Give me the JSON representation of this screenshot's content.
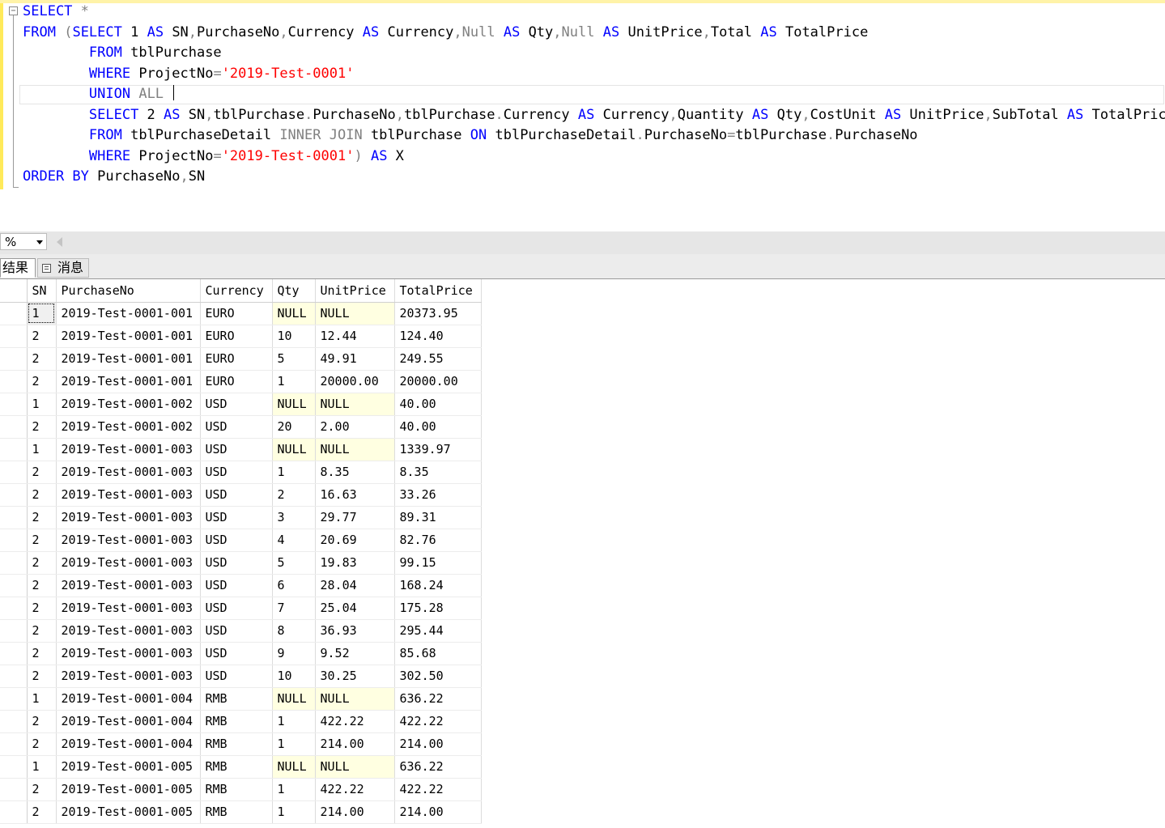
{
  "editor": {
    "collapse_symbol": "−",
    "lines": [
      [
        {
          "t": "SELECT",
          "c": "kw"
        },
        {
          "t": " ",
          "c": ""
        },
        {
          "t": "*",
          "c": "gr"
        }
      ],
      [
        {
          "t": "FROM",
          "c": "kw"
        },
        {
          "t": " ",
          "c": ""
        },
        {
          "t": "(",
          "c": "gr"
        },
        {
          "t": "SELECT",
          "c": "kw"
        },
        {
          "t": " 1 ",
          "c": ""
        },
        {
          "t": "AS",
          "c": "kw"
        },
        {
          "t": " SN",
          "c": ""
        },
        {
          "t": ",",
          "c": "gr"
        },
        {
          "t": "PurchaseNo",
          "c": ""
        },
        {
          "t": ",",
          "c": "gr"
        },
        {
          "t": "Currency ",
          "c": ""
        },
        {
          "t": "AS",
          "c": "kw"
        },
        {
          "t": " Currency",
          "c": ""
        },
        {
          "t": ",",
          "c": "gr"
        },
        {
          "t": "Null",
          "c": "gr"
        },
        {
          "t": " ",
          "c": ""
        },
        {
          "t": "AS",
          "c": "kw"
        },
        {
          "t": " Qty",
          "c": ""
        },
        {
          "t": ",",
          "c": "gr"
        },
        {
          "t": "Null",
          "c": "gr"
        },
        {
          "t": " ",
          "c": ""
        },
        {
          "t": "AS",
          "c": "kw"
        },
        {
          "t": " UnitPrice",
          "c": ""
        },
        {
          "t": ",",
          "c": "gr"
        },
        {
          "t": "Total ",
          "c": ""
        },
        {
          "t": "AS",
          "c": "kw"
        },
        {
          "t": " TotalPrice",
          "c": ""
        }
      ],
      [
        {
          "t": "        ",
          "c": ""
        },
        {
          "t": "FROM",
          "c": "kw"
        },
        {
          "t": " tblPurchase",
          "c": ""
        }
      ],
      [
        {
          "t": "        ",
          "c": ""
        },
        {
          "t": "WHERE",
          "c": "kw"
        },
        {
          "t": " ProjectNo",
          "c": ""
        },
        {
          "t": "=",
          "c": "gr"
        },
        {
          "t": "'2019-Test-0001'",
          "c": "str"
        }
      ],
      [
        {
          "t": "        ",
          "c": ""
        },
        {
          "t": "UNION",
          "c": "kw"
        },
        {
          "t": " ",
          "c": ""
        },
        {
          "t": "ALL",
          "c": "gr"
        },
        {
          "t": " ",
          "c": ""
        }
      ],
      [
        {
          "t": "        ",
          "c": ""
        },
        {
          "t": "SELECT",
          "c": "kw"
        },
        {
          "t": " 2 ",
          "c": ""
        },
        {
          "t": "AS",
          "c": "kw"
        },
        {
          "t": " SN",
          "c": ""
        },
        {
          "t": ",",
          "c": "gr"
        },
        {
          "t": "tblPurchase",
          "c": ""
        },
        {
          "t": ".",
          "c": "gr"
        },
        {
          "t": "PurchaseNo",
          "c": ""
        },
        {
          "t": ",",
          "c": "gr"
        },
        {
          "t": "tblPurchase",
          "c": ""
        },
        {
          "t": ".",
          "c": "gr"
        },
        {
          "t": "Currency ",
          "c": ""
        },
        {
          "t": "AS",
          "c": "kw"
        },
        {
          "t": " Currency",
          "c": ""
        },
        {
          "t": ",",
          "c": "gr"
        },
        {
          "t": "Quantity ",
          "c": ""
        },
        {
          "t": "AS",
          "c": "kw"
        },
        {
          "t": " Qty",
          "c": ""
        },
        {
          "t": ",",
          "c": "gr"
        },
        {
          "t": "CostUnit ",
          "c": ""
        },
        {
          "t": "AS",
          "c": "kw"
        },
        {
          "t": " UnitPrice",
          "c": ""
        },
        {
          "t": ",",
          "c": "gr"
        },
        {
          "t": "SubTotal ",
          "c": ""
        },
        {
          "t": "AS",
          "c": "kw"
        },
        {
          "t": " TotalPrice",
          "c": ""
        }
      ],
      [
        {
          "t": "        ",
          "c": ""
        },
        {
          "t": "FROM",
          "c": "kw"
        },
        {
          "t": " tblPurchaseDetail ",
          "c": ""
        },
        {
          "t": "INNER",
          "c": "gr"
        },
        {
          "t": " ",
          "c": ""
        },
        {
          "t": "JOIN",
          "c": "gr"
        },
        {
          "t": " tblPurchase ",
          "c": ""
        },
        {
          "t": "ON",
          "c": "kw"
        },
        {
          "t": " tblPurchaseDetail",
          "c": ""
        },
        {
          "t": ".",
          "c": "gr"
        },
        {
          "t": "PurchaseNo",
          "c": ""
        },
        {
          "t": "=",
          "c": "gr"
        },
        {
          "t": "tblPurchase",
          "c": ""
        },
        {
          "t": ".",
          "c": "gr"
        },
        {
          "t": "PurchaseNo",
          "c": ""
        }
      ],
      [
        {
          "t": "        ",
          "c": ""
        },
        {
          "t": "WHERE",
          "c": "kw"
        },
        {
          "t": " ProjectNo",
          "c": ""
        },
        {
          "t": "=",
          "c": "gr"
        },
        {
          "t": "'2019-Test-0001'",
          "c": "str"
        },
        {
          "t": ")",
          "c": "gr"
        },
        {
          "t": " ",
          "c": ""
        },
        {
          "t": "AS",
          "c": "kw"
        },
        {
          "t": " X",
          "c": ""
        }
      ],
      [
        {
          "t": "ORDER BY",
          "c": "kw"
        },
        {
          "t": " PurchaseNo",
          "c": ""
        },
        {
          "t": ",",
          "c": "gr"
        },
        {
          "t": "SN",
          "c": ""
        }
      ]
    ]
  },
  "zoom": {
    "value": "%"
  },
  "tabs": {
    "results": "结果",
    "messages": "消息"
  },
  "grid": {
    "columns": [
      "SN",
      "PurchaseNo",
      "Currency",
      "Qty",
      "UnitPrice",
      "TotalPrice"
    ],
    "rows": [
      [
        "1",
        "2019-Test-0001-001",
        "EURO",
        "NULL",
        "NULL",
        "20373.95"
      ],
      [
        "2",
        "2019-Test-0001-001",
        "EURO",
        "10",
        "12.44",
        "124.40"
      ],
      [
        "2",
        "2019-Test-0001-001",
        "EURO",
        "5",
        "49.91",
        "249.55"
      ],
      [
        "2",
        "2019-Test-0001-001",
        "EURO",
        "1",
        "20000.00",
        "20000.00"
      ],
      [
        "1",
        "2019-Test-0001-002",
        "USD",
        "NULL",
        "NULL",
        "40.00"
      ],
      [
        "2",
        "2019-Test-0001-002",
        "USD",
        "20",
        "2.00",
        "40.00"
      ],
      [
        "1",
        "2019-Test-0001-003",
        "USD",
        "NULL",
        "NULL",
        "1339.97"
      ],
      [
        "2",
        "2019-Test-0001-003",
        "USD",
        "1",
        "8.35",
        "8.35"
      ],
      [
        "2",
        "2019-Test-0001-003",
        "USD",
        "2",
        "16.63",
        "33.26"
      ],
      [
        "2",
        "2019-Test-0001-003",
        "USD",
        "3",
        "29.77",
        "89.31"
      ],
      [
        "2",
        "2019-Test-0001-003",
        "USD",
        "4",
        "20.69",
        "82.76"
      ],
      [
        "2",
        "2019-Test-0001-003",
        "USD",
        "5",
        "19.83",
        "99.15"
      ],
      [
        "2",
        "2019-Test-0001-003",
        "USD",
        "6",
        "28.04",
        "168.24"
      ],
      [
        "2",
        "2019-Test-0001-003",
        "USD",
        "7",
        "25.04",
        "175.28"
      ],
      [
        "2",
        "2019-Test-0001-003",
        "USD",
        "8",
        "36.93",
        "295.44"
      ],
      [
        "2",
        "2019-Test-0001-003",
        "USD",
        "9",
        "9.52",
        "85.68"
      ],
      [
        "2",
        "2019-Test-0001-003",
        "USD",
        "10",
        "30.25",
        "302.50"
      ],
      [
        "1",
        "2019-Test-0001-004",
        "RMB",
        "NULL",
        "NULL",
        "636.22"
      ],
      [
        "2",
        "2019-Test-0001-004",
        "RMB",
        "1",
        "422.22",
        "422.22"
      ],
      [
        "2",
        "2019-Test-0001-004",
        "RMB",
        "1",
        "214.00",
        "214.00"
      ],
      [
        "1",
        "2019-Test-0001-005",
        "RMB",
        "NULL",
        "NULL",
        "636.22"
      ],
      [
        "2",
        "2019-Test-0001-005",
        "RMB",
        "1",
        "422.22",
        "422.22"
      ],
      [
        "2",
        "2019-Test-0001-005",
        "RMB",
        "1",
        "214.00",
        "214.00"
      ]
    ]
  }
}
